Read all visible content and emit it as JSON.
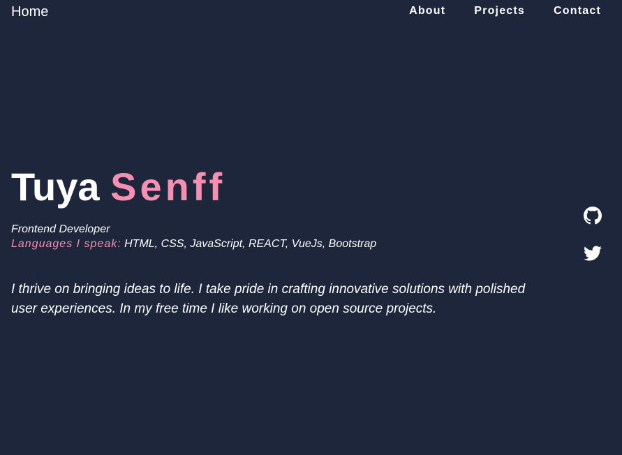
{
  "nav": {
    "home": "Home",
    "links": [
      "About",
      "Projects",
      "Contact"
    ]
  },
  "hero": {
    "first_name": "Tuya",
    "last_name": "Senff",
    "role": "Frontend Developer",
    "languages_label": "Languages I speak:",
    "languages": "HTML, CSS, JavaScript, REACT, VueJs, Bootstrap",
    "bio": "I thrive on bringing ideas to life. I take pride in crafting innovative solutions with polished user experiences. In my free time I like working on open source projects."
  },
  "social": {
    "icons": [
      "github-icon",
      "twitter-icon"
    ]
  },
  "colors": {
    "background": "#1d263b",
    "text": "#ffffff",
    "accent": "#f78fb3"
  }
}
